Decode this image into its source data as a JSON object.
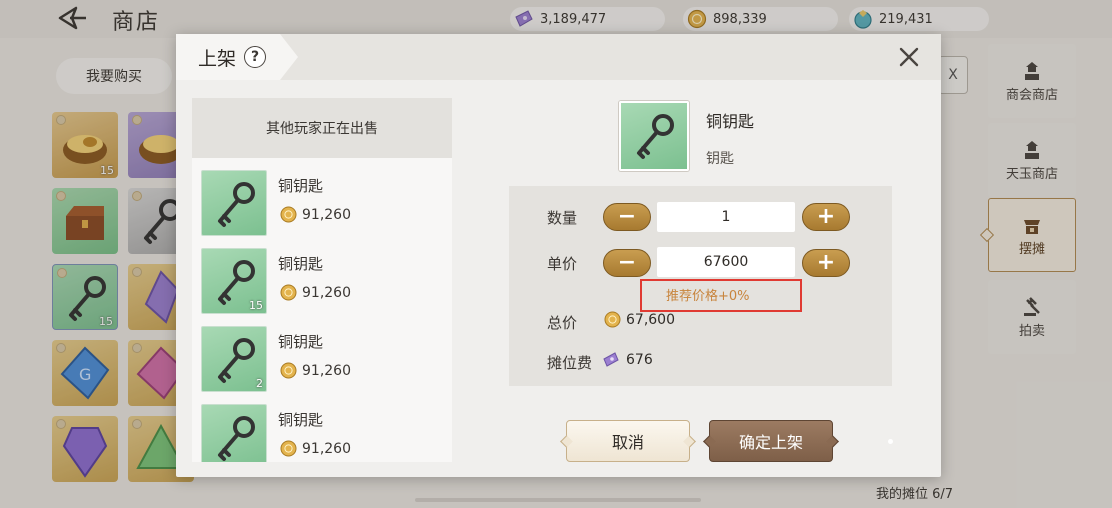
{
  "header": {
    "title": "商店",
    "currencies": [
      {
        "icon": "purple-ticket-icon",
        "value": "3,189,477"
      },
      {
        "icon": "gold-coin-icon",
        "value": "898,339"
      },
      {
        "icon": "jade-coin-icon",
        "value": "219,431"
      }
    ]
  },
  "tabs": {
    "buy": "我要购买"
  },
  "grid_counts": [
    "15",
    "",
    "",
    "",
    "",
    "15",
    "",
    "",
    "",
    ""
  ],
  "right_nav": [
    {
      "label": "商会商店",
      "icon": "guild-shop-icon"
    },
    {
      "label": "天玉商店",
      "icon": "jade-shop-icon"
    },
    {
      "label": "摆摊",
      "icon": "stall-icon"
    },
    {
      "label": "拍卖",
      "icon": "auction-gavel-icon"
    }
  ],
  "search_stub": "X",
  "stall_count": "我的摊位 6/7",
  "modal": {
    "title": "上架",
    "help": "?",
    "list_header": "其他玩家正在出售",
    "listings": [
      {
        "name": "铜钥匙",
        "price": "91,260",
        "count": ""
      },
      {
        "name": "铜钥匙",
        "price": "91,260",
        "count": "15"
      },
      {
        "name": "铜钥匙",
        "price": "91,260",
        "count": "2"
      },
      {
        "name": "铜钥匙",
        "price": "91,260",
        "count": ""
      }
    ],
    "item": {
      "name": "铜钥匙",
      "type": "钥匙"
    },
    "quantity_label": "数量",
    "quantity_value": "1",
    "unit_price_label": "单价",
    "unit_price_value": "67600",
    "minus": "−",
    "plus": "+",
    "price_hint": "推荐价格+0%",
    "total_label": "总价",
    "total_value": "67,600",
    "fee_label": "摊位费",
    "fee_value": "676",
    "cancel": "取消",
    "confirm": "确定上架"
  },
  "colors": {
    "accent_gold": "#a77a30",
    "confirm_brown": "#7e5f48",
    "hint_orange": "#c8843c",
    "highlight_red": "#e03a32",
    "item_green": "#7cc090"
  }
}
